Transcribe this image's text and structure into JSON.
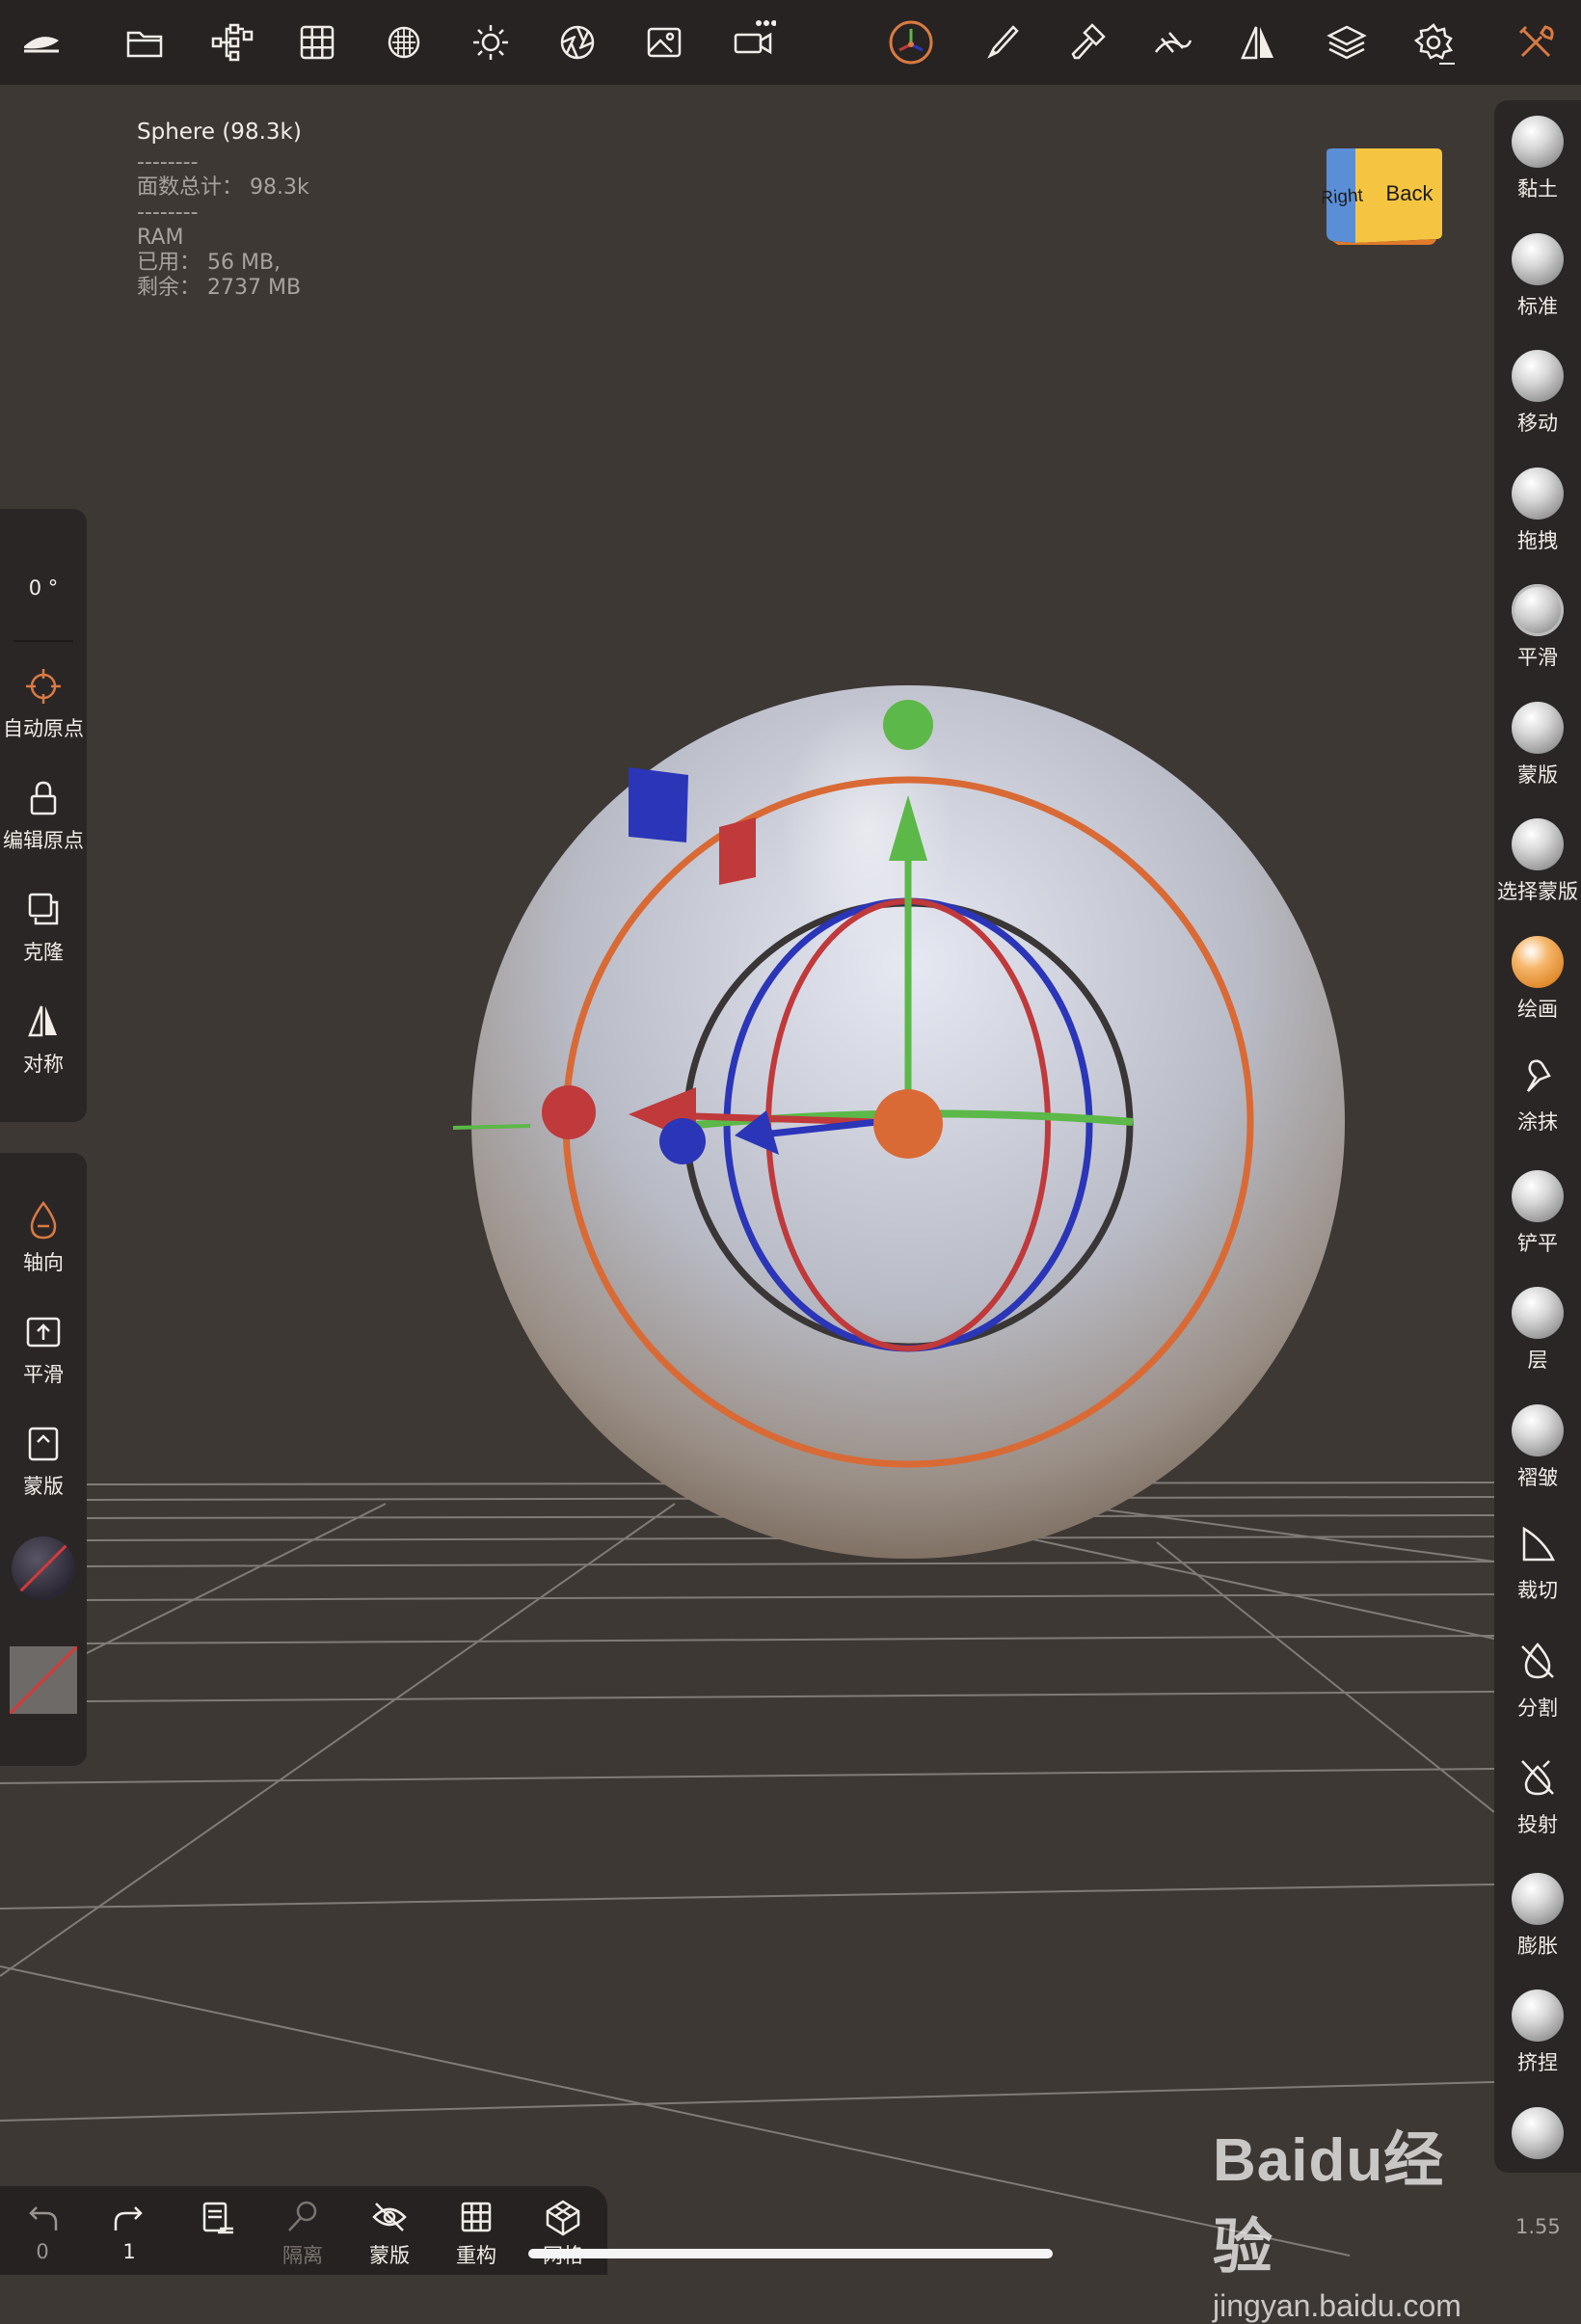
{
  "info": {
    "object": "Sphere (98.3k)",
    "sep1": "--------",
    "faces": "面数总计：  98.3k",
    "sep2": "--------",
    "ram": "RAM",
    "used": "已用：  56 MB,",
    "free": "剩余：  2737 MB"
  },
  "view_cube": {
    "face_left": "Right",
    "face_right": "Back",
    "left_color": "#5a8fd8",
    "right_color": "#f5c542"
  },
  "top_toolbar": [
    "menu-icon",
    "folder-icon",
    "scene-tree-icon",
    "grid-icon",
    "topology-icon",
    "light-icon",
    "camera-lens-icon",
    "image-icon",
    "video-icon",
    "gizmo-icon",
    "brush-icon",
    "paint-icon",
    "stroke-icon",
    "symmetry-icon",
    "layers-icon",
    "settings-icon",
    "tools-icon"
  ],
  "left_panel": {
    "angle": "0 °",
    "auto_origin": "自动原点",
    "edit_origin": "编辑原点",
    "clone": "克隆",
    "symmetry": "对称",
    "axis": "轴向",
    "smooth": "平滑",
    "mask": "蒙版"
  },
  "right_tools": [
    "黏土",
    "标准",
    "移动",
    "拖拽",
    "平滑",
    "蒙版",
    "选择蒙版",
    "绘画",
    "涂抹",
    "铲平",
    "层",
    "褶皱",
    "裁切",
    "分割",
    "投射",
    "膨胀",
    "挤捏"
  ],
  "bottom_bar": {
    "undo_count": "0",
    "redo_count": "1",
    "isolate": "隔离",
    "mask": "蒙版",
    "remesh": "重构",
    "wireframe": "网格"
  },
  "zoom": "1.55",
  "watermark": {
    "brand": "Baidu经验",
    "url": "jingyan.baidu.com"
  },
  "colors": {
    "gizmo_x": "#c0393b",
    "gizmo_y": "#5cb848",
    "gizmo_z": "#2b35b8",
    "gizmo_ring": "#d96a35",
    "accent": "#d97a44"
  }
}
